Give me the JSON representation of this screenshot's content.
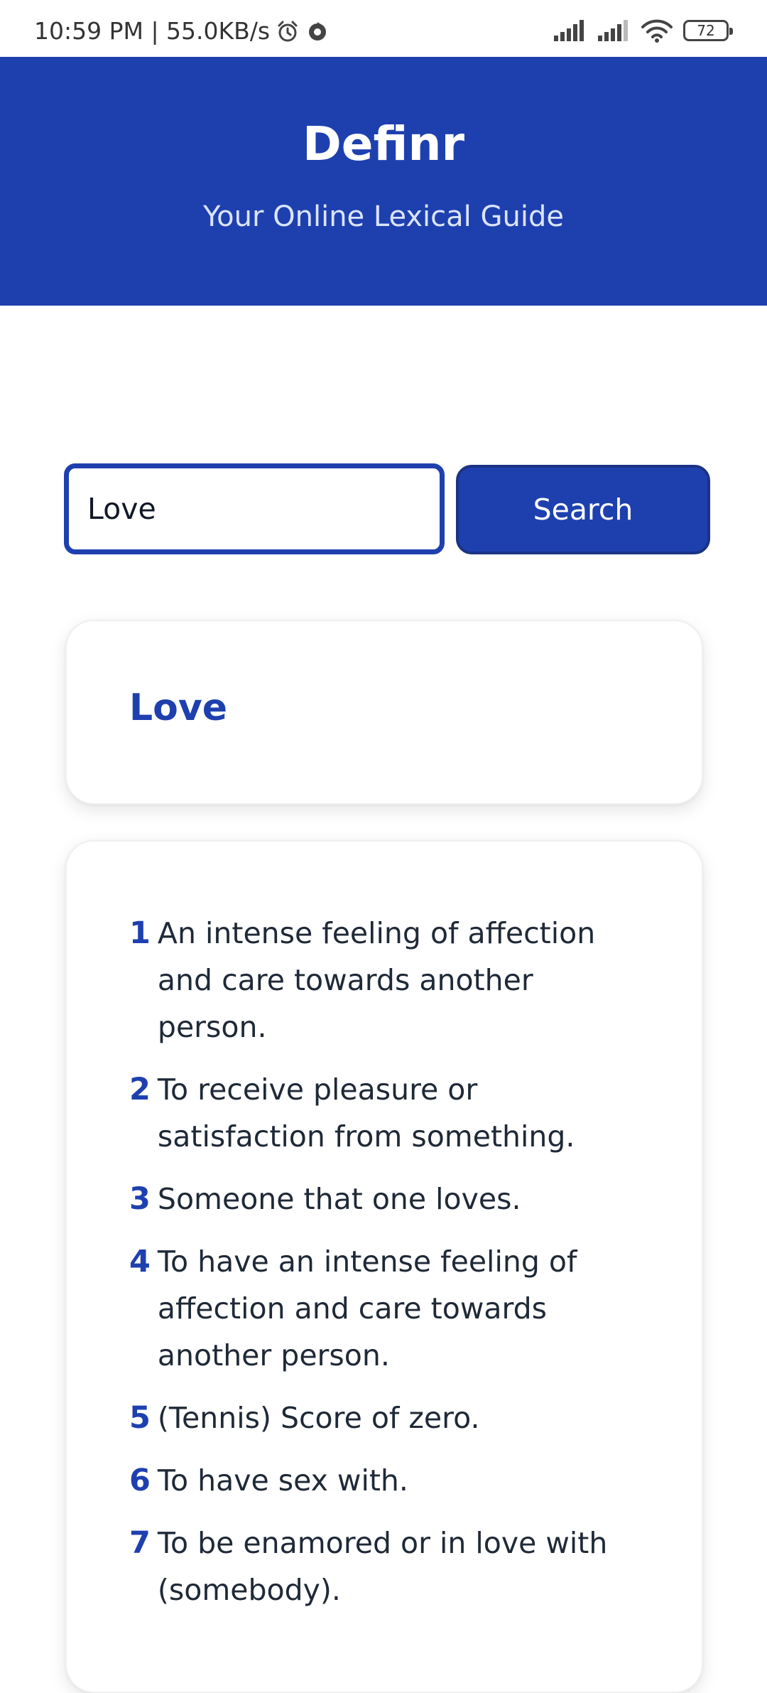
{
  "status_bar": {
    "time_speed": "10:59 PM | 55.0KB/s",
    "battery": "72",
    "icons": [
      "alarm-icon",
      "sync-icon",
      "signal-icon",
      "signal-icon",
      "wifi-icon",
      "battery-icon"
    ]
  },
  "header": {
    "title": "Definr",
    "subtitle": "Your Online Lexical Guide"
  },
  "search": {
    "value": "Love",
    "button_label": "Search"
  },
  "result": {
    "word": "Love",
    "definitions": [
      {
        "num": "1",
        "text": "An intense feeling of affection and care towards another person."
      },
      {
        "num": "2",
        "text": "To receive pleasure or satisfaction from something."
      },
      {
        "num": "3",
        "text": "Someone that one loves."
      },
      {
        "num": "4",
        "text": "To have an intense feeling of affection and care towards another person."
      },
      {
        "num": "5",
        "text": "(Tennis) Score of zero."
      },
      {
        "num": "6",
        "text": "To have sex with."
      },
      {
        "num": "7",
        "text": "To be enamored or in love with (somebody)."
      }
    ]
  },
  "colors": {
    "primary": "#1e40af",
    "background": "#ffffff"
  }
}
